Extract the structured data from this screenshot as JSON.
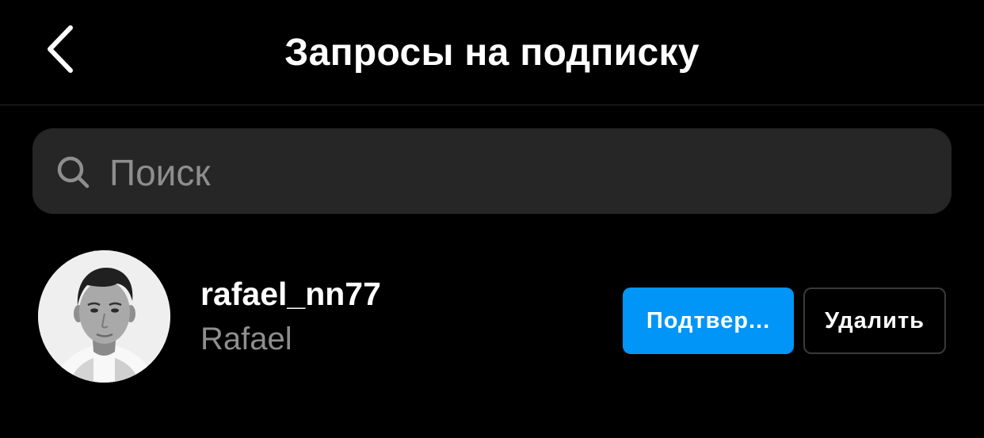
{
  "header": {
    "title": "Запросы на подписку",
    "back_icon": "chevron-left-icon"
  },
  "search": {
    "placeholder": "Поиск",
    "value": "",
    "icon": "search-icon"
  },
  "requests": [
    {
      "username": "rafael_nn77",
      "full_name": "Rafael",
      "confirm_label": "Подтвер...",
      "delete_label": "Удалить"
    }
  ],
  "colors": {
    "background": "#000000",
    "search_bg": "#262626",
    "accent": "#0095f6",
    "secondary_text": "#8e8e8e",
    "divider": "#262626"
  }
}
